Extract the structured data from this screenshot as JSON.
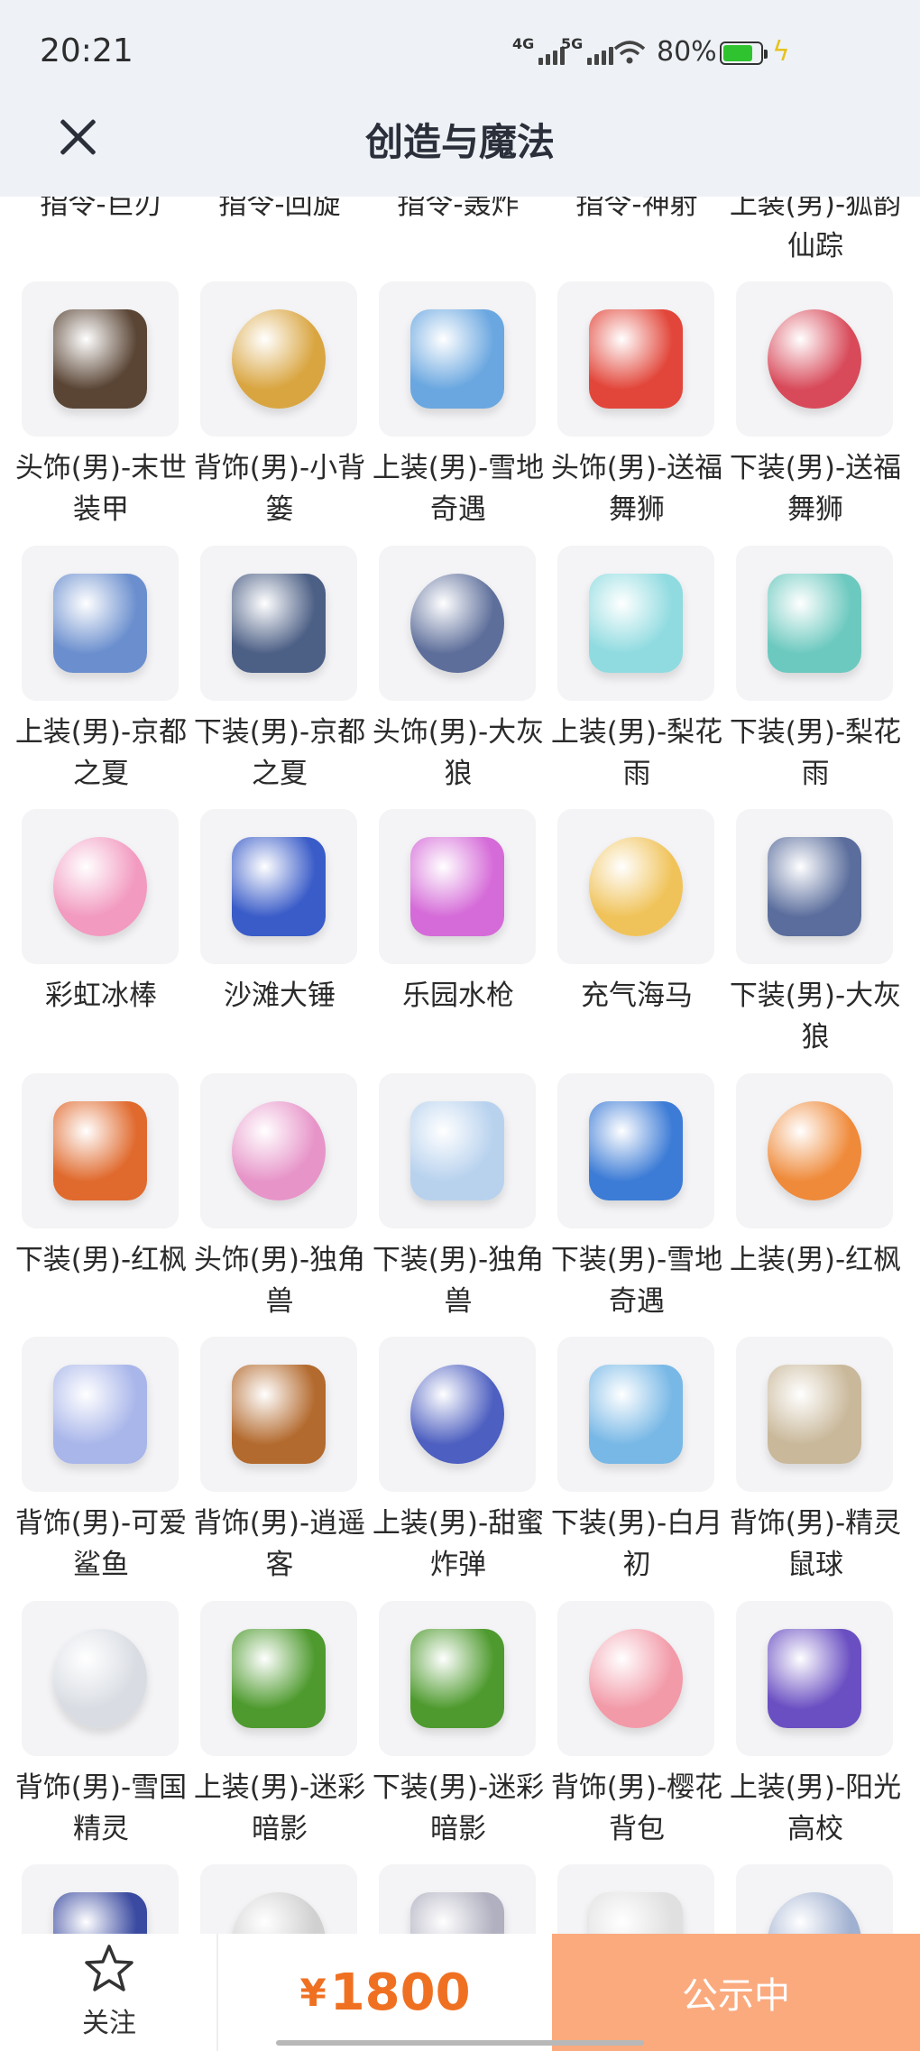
{
  "status_bar": {
    "time": "20:21",
    "net1": "4G",
    "net2": "5G",
    "battery": "80%"
  },
  "header": {
    "title": "创造与魔法"
  },
  "items": [
    {
      "label": "指令-巨刃",
      "icon": "blade-icon",
      "color": "#9aa3b3"
    },
    {
      "label": "指令-回旋",
      "icon": "boomerang-icon",
      "color": "#b5a08a"
    },
    {
      "label": "指令-轰炸",
      "icon": "bomb-icon",
      "color": "#8c8f99"
    },
    {
      "label": "指令-神射",
      "icon": "arrow-icon",
      "color": "#7fc7c2"
    },
    {
      "label": "上装(男)-狐韵仙踪",
      "icon": "robe-icon",
      "color": "#a8b9d6"
    },
    {
      "label": "头饰(男)-末世装甲",
      "icon": "armor-helmet-icon",
      "color": "#5a4535"
    },
    {
      "label": "背饰(男)-小背篓",
      "icon": "flower-basket-icon",
      "color": "#d9a540"
    },
    {
      "label": "上装(男)-雪地奇遇",
      "icon": "snow-coat-icon",
      "color": "#6aa7e0"
    },
    {
      "label": "头饰(男)-送福舞狮",
      "icon": "lion-dance-icon",
      "color": "#e2463a"
    },
    {
      "label": "下装(男)-送福舞狮",
      "icon": "pants-icon",
      "color": "#d84a5a"
    },
    {
      "label": "上装(男)-京都之夏",
      "icon": "kimono-icon",
      "color": "#6b8fce"
    },
    {
      "label": "下装(男)-京都之夏",
      "icon": "pants-icon",
      "color": "#4c5f85"
    },
    {
      "label": "头饰(男)-大灰狼",
      "icon": "wolf-hood-icon",
      "color": "#5d6e9a"
    },
    {
      "label": "上装(男)-梨花雨",
      "icon": "robe-icon",
      "color": "#8fdbe0"
    },
    {
      "label": "下装(男)-梨花雨",
      "icon": "boots-icon",
      "color": "#6cc9bf"
    },
    {
      "label": "彩虹冰棒",
      "icon": "popsicle-icon",
      "color": "#f29ac0"
    },
    {
      "label": "沙滩大锤",
      "icon": "hammer-icon",
      "color": "#3a5cc8"
    },
    {
      "label": "乐园水枪",
      "icon": "water-gun-icon",
      "color": "#d56bd8"
    },
    {
      "label": "充气海马",
      "icon": "bow-icon",
      "color": "#f0c35a"
    },
    {
      "label": "下装(男)-大灰狼",
      "icon": "pants-icon",
      "color": "#5a6d9c"
    },
    {
      "label": "下装(男)-红枫",
      "icon": "maple-shorts-icon",
      "color": "#e06a2e"
    },
    {
      "label": "头饰(男)-独角兽",
      "icon": "unicorn-hood-icon",
      "color": "#e795c9"
    },
    {
      "label": "下装(男)-独角兽",
      "icon": "shoes-icon",
      "color": "#b8d2ee"
    },
    {
      "label": "下装(男)-雪地奇遇",
      "icon": "pants-icon",
      "color": "#3d7cd6"
    },
    {
      "label": "上装(男)-红枫",
      "icon": "robe-icon",
      "color": "#ef8a3a"
    },
    {
      "label": "背饰(男)-可爱鲨鱼",
      "icon": "shark-icon",
      "color": "#a9b6ea"
    },
    {
      "label": "背饰(男)-逍遥客",
      "icon": "sword-icon",
      "color": "#b36a2e"
    },
    {
      "label": "上装(男)-甜蜜炸弹",
      "icon": "suit-icon",
      "color": "#4d5fc0"
    },
    {
      "label": "下装(男)-白月初",
      "icon": "pants-icon",
      "color": "#78b8e6"
    },
    {
      "label": "背饰(男)-精灵鼠球",
      "icon": "mouse-ball-icon",
      "color": "#c9b89a"
    },
    {
      "label": "背饰(男)-雪国精灵",
      "icon": "wing-icon",
      "color": "#d9dde3"
    },
    {
      "label": "上装(男)-迷彩暗影",
      "icon": "ghillie-top-icon",
      "color": "#4e9a2e"
    },
    {
      "label": "下装(男)-迷彩暗影",
      "icon": "ghillie-pants-icon",
      "color": "#4e9a2e"
    },
    {
      "label": "背饰(男)-樱花背包",
      "icon": "sakura-bag-icon",
      "color": "#f29aa8"
    },
    {
      "label": "上装(男)-阳光高校",
      "icon": "school-jacket-icon",
      "color": "#6a4fc2"
    },
    {
      "label": "",
      "icon": "item-icon",
      "color": "#3a4aa0"
    },
    {
      "label": "",
      "icon": "item-icon",
      "color": "#d0d0d0"
    },
    {
      "label": "",
      "icon": "item-icon",
      "color": "#b0b0c0"
    },
    {
      "label": "",
      "icon": "item-icon",
      "color": "#e0e0e0"
    },
    {
      "label": "",
      "icon": "item-icon",
      "color": "#a0b0d0"
    }
  ],
  "bottom": {
    "follow_label": "关注",
    "currency": "¥",
    "price": "1800",
    "status": "公示中"
  },
  "colors": {
    "accent": "#f07022",
    "status_button": "#fbaa7e",
    "header_bg": "#eef2f7"
  }
}
